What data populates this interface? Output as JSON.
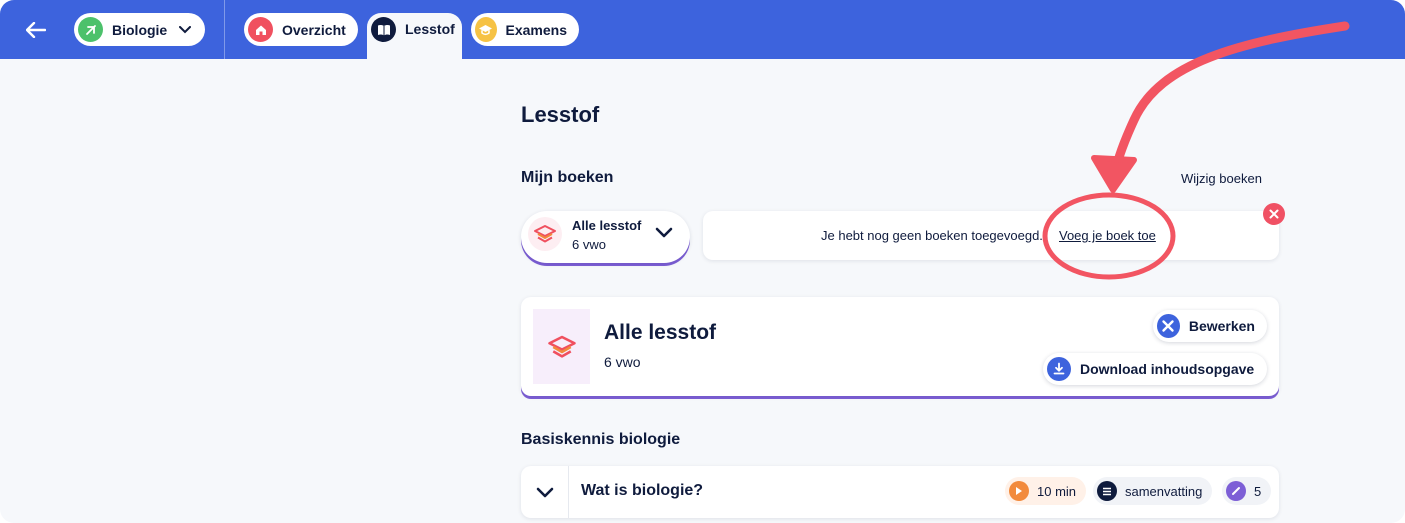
{
  "topbar": {
    "subject": "Biologie",
    "tabs": {
      "overzicht": "Overzicht",
      "lesstof": "Lesstof",
      "examens": "Examens"
    }
  },
  "page": {
    "title": "Lesstof",
    "my_books_heading": "Mijn boeken",
    "change_books_link": "Wijzig boeken"
  },
  "book_selector": {
    "title": "Alle lesstof",
    "level": "6 vwo"
  },
  "notice": {
    "message": "Je hebt nog geen boeken toegevoegd.",
    "link": "Voeg je boek toe"
  },
  "book_card": {
    "title": "Alle lesstof",
    "level": "6 vwo",
    "edit_label": "Bewerken",
    "download_label": "Download inhoudsopgave"
  },
  "section": {
    "heading": "Basiskennis biologie"
  },
  "chapter": {
    "title": "Wat is biologie?",
    "duration": "10 min",
    "type": "samenvatting",
    "count": "5"
  },
  "colors": {
    "topbar": "#3d63dd",
    "accent_purple": "#7d5fd6",
    "annotation_red": "#f25562",
    "subject_green": "#4cc16b",
    "home_red": "#f0505f",
    "exam_yellow": "#f6c244"
  },
  "icons": {
    "back": "arrow-left-icon",
    "subject": "leaf-icon",
    "overzicht": "home-icon",
    "lesstof": "book-open-icon",
    "examens": "graduation-cap-icon",
    "edit": "tools-icon",
    "download": "download-icon",
    "duration": "play-icon",
    "summary": "list-icon",
    "count": "pencil-icon"
  }
}
